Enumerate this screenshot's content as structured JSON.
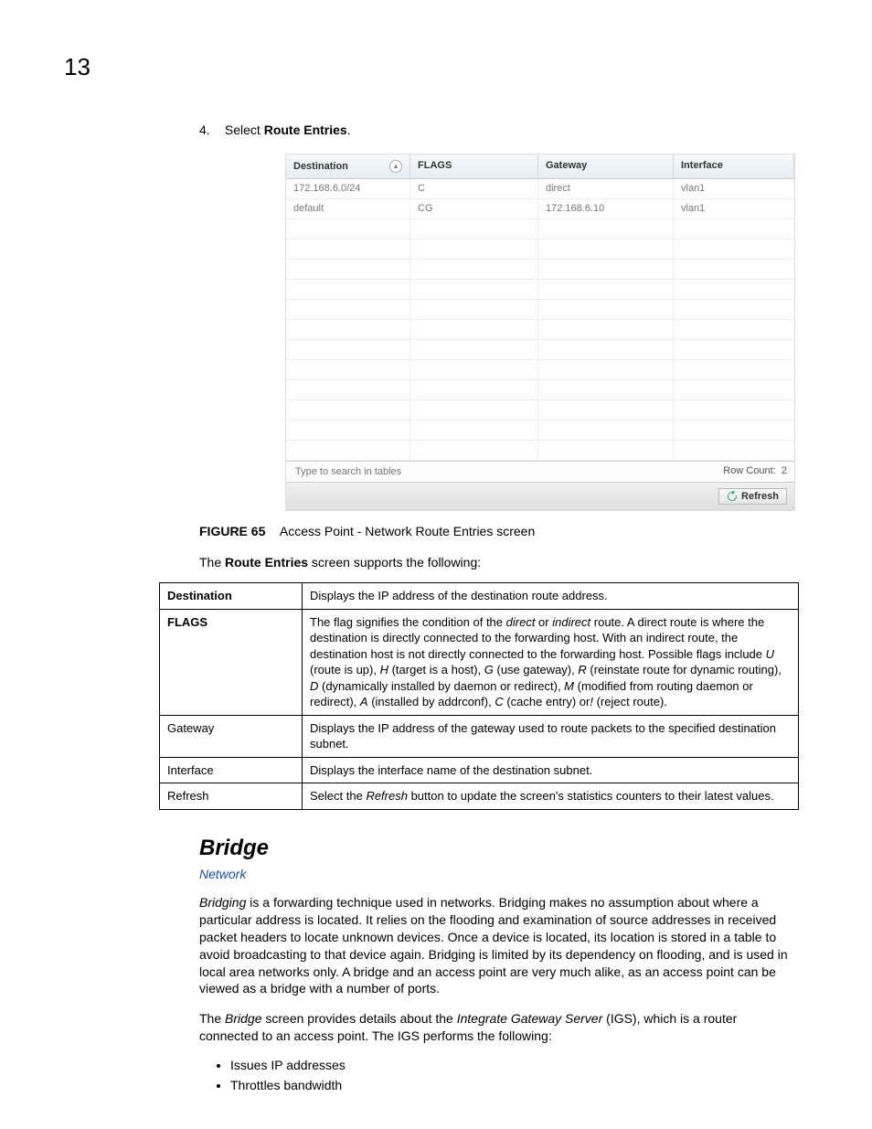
{
  "page_number": "13",
  "step": {
    "num": "4.",
    "prefix": "Select ",
    "bold": "Route Entries",
    "suffix": "."
  },
  "route_table": {
    "headers": {
      "destination": "Destination",
      "flags": "FLAGS",
      "gateway": "Gateway",
      "interface": "Interface"
    },
    "rows": [
      {
        "destination": "172.168.6.0/24",
        "flags": "C",
        "gateway": "direct",
        "interface": "vlan1"
      },
      {
        "destination": "default",
        "flags": "CG",
        "gateway": "172.168.6.10",
        "interface": "vlan1"
      }
    ],
    "empty_rows": 12,
    "search_placeholder": "Type to search in tables",
    "row_count_label": "Row Count:",
    "row_count_value": "2",
    "refresh_label": "Refresh"
  },
  "figure": {
    "label": "FIGURE 65",
    "caption": "Access Point - Network Route Entries screen"
  },
  "support_text": {
    "pre": "The ",
    "bold": "Route Entries",
    "post": " screen supports the following:"
  },
  "desc_rows": [
    {
      "field": "Destination",
      "bold": true,
      "desc": "Displays the IP address of the destination route address."
    },
    {
      "field": "FLAGS",
      "bold": true,
      "desc_html": "The flag signifies the condition of the <i>direct</i> or <i>indirect</i> route. A direct route is where the destination is directly connected to the forwarding host. With an indirect route, the destination host is not directly connected to the forwarding host. Possible flags include <i>U</i> (route is up), <i>H</i> (target is a host), <i>G</i> (use gateway), <i>R</i> (reinstate route for dynamic routing), <i>D</i> (dynamically installed by daemon or redirect), <i>M</i> (modified from routing daemon or redirect), <i>A</i> (installed by addrconf), <i>C</i> (cache entry) or<i>!</i> (reject route)."
    },
    {
      "field": "Gateway",
      "bold": false,
      "desc": "Displays the IP address of the gateway used to route packets to the specified destination subnet."
    },
    {
      "field": "Interface",
      "bold": false,
      "desc": "Displays the interface name of the destination subnet."
    },
    {
      "field": "Refresh",
      "bold": false,
      "desc_html": "Select the <i>Refresh</i> button to update the screen's statistics counters to their latest values."
    }
  ],
  "section_heading": "Bridge",
  "network_link": "Network",
  "para1_html": "<i>Bridging</i> is a forwarding technique used in networks. Bridging makes no assumption about where a particular address is located. It relies on the flooding and examination of source addresses in received packet headers to locate unknown devices. Once a device is located, its location is stored in a table to avoid broadcasting to that device again. Bridging is limited by its dependency on flooding, and is used in local area networks only. A bridge and an access point are very much alike, as an access point can be viewed as a bridge with a number of ports.",
  "para2_html": "The <i>Bridge</i> screen provides details about the <i>Integrate Gateway Server</i> (IGS), which is a router connected to an access point. The IGS performs the following:",
  "bullets": [
    "Issues IP addresses",
    "Throttles bandwidth"
  ]
}
